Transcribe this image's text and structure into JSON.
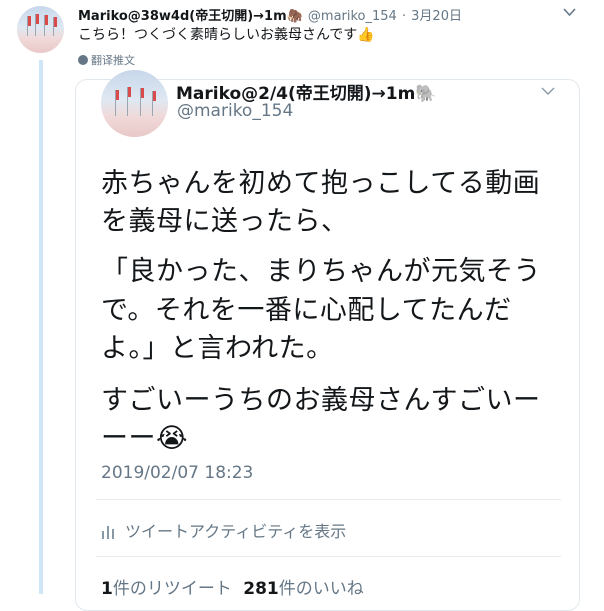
{
  "outer_tweet": {
    "name": "Mariko@38w4d(帝王切開)→1m",
    "name_emoji": "🦣",
    "handle": "@mariko_154",
    "separator": "·",
    "date": "3月20日",
    "text": "こちら！つくづく素晴らしいお義母さんです",
    "text_emoji": "👍",
    "translate_label": "翻译推文"
  },
  "quoted_tweet": {
    "name": "Mariko@2/4(帝王切開)→1m",
    "name_emoji": "🐘",
    "handle": "@mariko_154",
    "lines": [
      "赤ちゃんを初めて抱っこしてる動画",
      "を義母に送ったら、",
      "「良かった、まりちゃんが元気そう",
      "で。それを一番に心配してたんだ",
      "よ。」と言われた。",
      "すごいーうちのお義母さんすごいー",
      "ーー"
    ],
    "last_emoji": "😭",
    "timestamp": "2019/02/07 18:23",
    "activity_label": "ツイートアクティビティを表示",
    "retweet_count": "1",
    "retweet_label": "件のリツイート",
    "like_count": "281",
    "like_label": "件のいいね"
  }
}
